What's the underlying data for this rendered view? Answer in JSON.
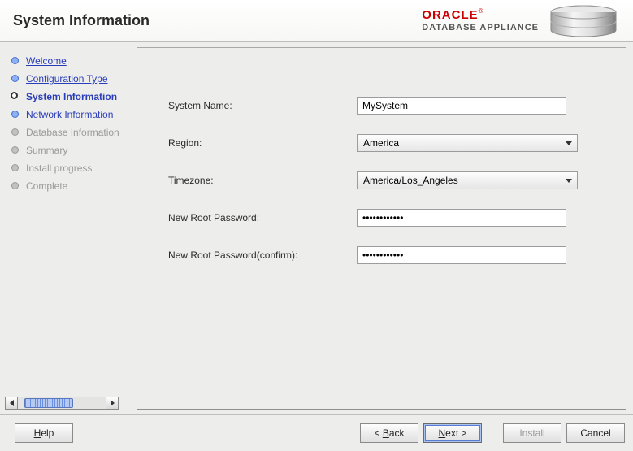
{
  "header": {
    "title": "System Information",
    "brand_line1": "ORACLE",
    "brand_reg": "®",
    "brand_line2": "DATABASE APPLIANCE"
  },
  "sidebar": {
    "steps": [
      {
        "label": "Welcome",
        "state": "done"
      },
      {
        "label": "Configuration Type",
        "state": "done"
      },
      {
        "label": "System Information",
        "state": "current"
      },
      {
        "label": "Network Information",
        "state": "next"
      },
      {
        "label": "Database Information",
        "state": "future"
      },
      {
        "label": "Summary",
        "state": "future"
      },
      {
        "label": "Install progress",
        "state": "future"
      },
      {
        "label": "Complete",
        "state": "future"
      }
    ]
  },
  "form": {
    "system_name": {
      "label": "System Name:",
      "value": "MySystem"
    },
    "region": {
      "label": "Region:",
      "value": "America"
    },
    "timezone": {
      "label": "Timezone:",
      "value": "America/Los_Angeles"
    },
    "root_pw": {
      "label": "New Root Password:",
      "mask": "••••••••••••"
    },
    "root_pw2": {
      "label": "New Root Password(confirm):",
      "mask": "••••••••••••"
    }
  },
  "footer": {
    "help": "Help",
    "back": "Back",
    "next": "Next >",
    "install": "Install",
    "cancel": "Cancel"
  }
}
